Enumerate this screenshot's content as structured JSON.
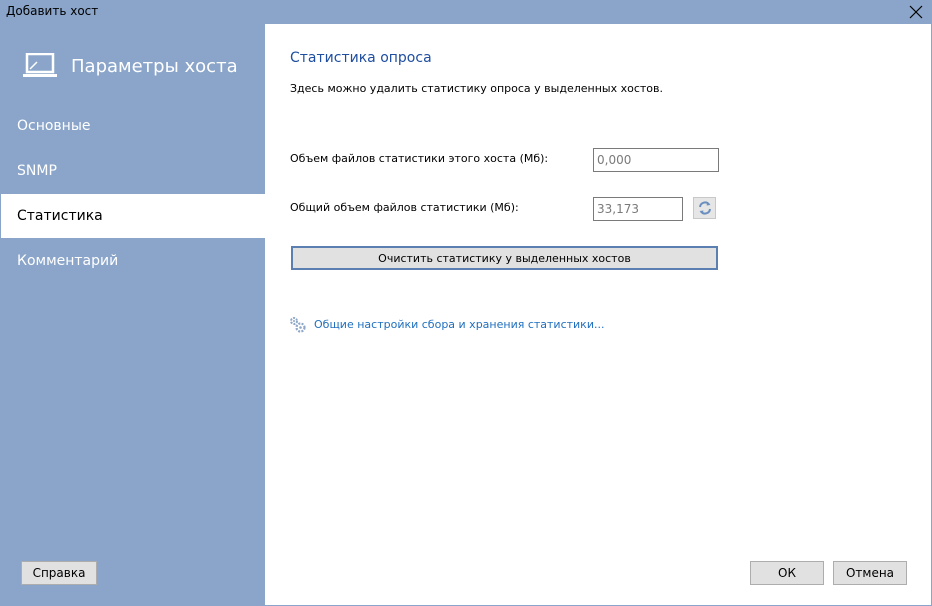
{
  "window": {
    "title": "Добавить хост",
    "close_icon": "close-icon"
  },
  "sidebar": {
    "header": {
      "icon": "laptop-icon",
      "label": "Параметры хоста"
    },
    "items": [
      {
        "label": "Основные",
        "active": false
      },
      {
        "label": "SNMP",
        "active": false
      },
      {
        "label": "Статистика",
        "active": true
      },
      {
        "label": "Комментарий",
        "active": false
      }
    ],
    "help_label": "Справка"
  },
  "main": {
    "title": "Статистика опроса",
    "description": "Здесь можно удалить статистику опроса у выделенных хостов.",
    "host_size": {
      "label": "Объем файлов статистики этого хоста (Мб):",
      "value": "0,000"
    },
    "total_size": {
      "label": "Общий объем файлов статистики (Мб):",
      "value": "33,173",
      "refresh_icon": "refresh-icon"
    },
    "clear_button": "Очистить статистику у выделенных хостов",
    "settings_link": {
      "icon": "gears-icon",
      "label": "Общие настройки сбора и хранения статистики..."
    }
  },
  "footer": {
    "ok_label": "ОК",
    "cancel_label": "Отмена"
  },
  "colors": {
    "sidebar_bg": "#8aa5c9",
    "accent_title": "#1f4ea0",
    "link": "#1f6fbf"
  }
}
